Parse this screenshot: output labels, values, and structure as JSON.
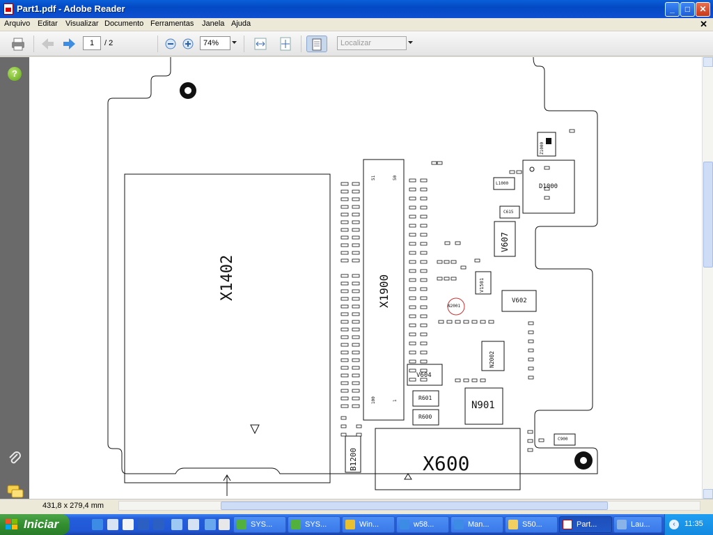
{
  "window": {
    "title": "Part1.pdf - Adobe Reader",
    "min": "_",
    "max": "□",
    "close": "✕"
  },
  "menu": {
    "items": [
      "Arquivo",
      "Editar",
      "Visualizar",
      "Documento",
      "Ferramentas",
      "Janela",
      "Ajuda"
    ],
    "close": "✕"
  },
  "toolbar": {
    "page_current": "1",
    "page_total": "/ 2",
    "zoom": "74%",
    "search_placeholder": "Localizar"
  },
  "sidebar": {
    "help_icon": "?"
  },
  "status": {
    "page_size": "431,8 x 279,4 mm"
  },
  "pcb": {
    "big_labels": {
      "x1402": "X1402",
      "x1900": "X1900",
      "x600": "X600",
      "n901": "N901",
      "v607": "V607",
      "v602": "V602",
      "v604": "V604",
      "d1000": "D1000",
      "b1200": "B1200",
      "r601": "R601",
      "r600": "R600",
      "n2002": "N2002",
      "v1501": "V1501",
      "l1000": "L1000",
      "c615": "C615",
      "n2001": "N2001",
      "z1000": "Z1000",
      "c900": "C900"
    },
    "pin_labels": {
      "p51": "51",
      "p50": "50",
      "p100": "100",
      "p1": "1"
    }
  },
  "taskbar": {
    "start": "Iniciar",
    "tasks": [
      "SYS...",
      "SYS...",
      "Win...",
      "w58...",
      "Man...",
      "S50...",
      "Part...",
      "Lau..."
    ],
    "clock": "11:35"
  },
  "colors": {
    "accent": "#245edb",
    "start": "#328f2f",
    "title": "#0349c4"
  }
}
